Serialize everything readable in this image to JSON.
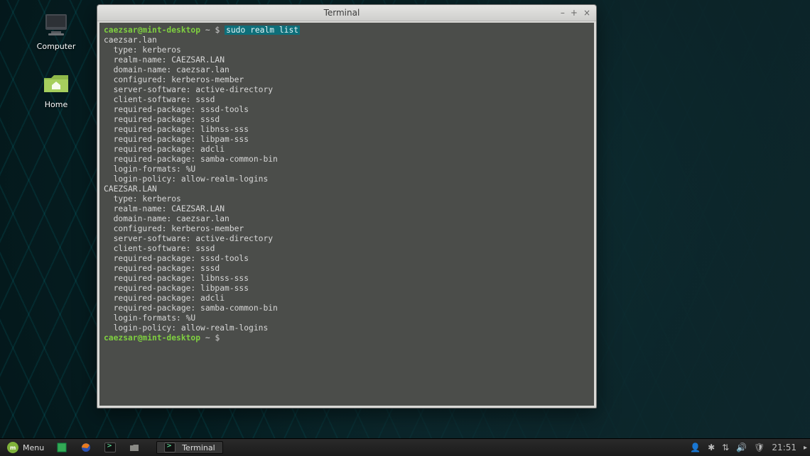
{
  "desktop": {
    "icons": [
      {
        "name": "computer",
        "label": "Computer"
      },
      {
        "name": "home",
        "label": "Home"
      }
    ]
  },
  "window": {
    "title": "Terminal",
    "controls": {
      "minimize": "–",
      "maximize": "+",
      "close": "×"
    }
  },
  "terminal": {
    "user": "caezsar",
    "host": "mint-desktop",
    "cwd": "~",
    "command": "sudo realm list",
    "output_lines": [
      "caezsar.lan",
      "  type: kerberos",
      "  realm-name: CAEZSAR.LAN",
      "  domain-name: caezsar.lan",
      "  configured: kerberos-member",
      "  server-software: active-directory",
      "  client-software: sssd",
      "  required-package: sssd-tools",
      "  required-package: sssd",
      "  required-package: libnss-sss",
      "  required-package: libpam-sss",
      "  required-package: adcli",
      "  required-package: samba-common-bin",
      "  login-formats: %U",
      "  login-policy: allow-realm-logins",
      "CAEZSAR.LAN",
      "  type: kerberos",
      "  realm-name: CAEZSAR.LAN",
      "  domain-name: caezsar.lan",
      "  configured: kerberos-member",
      "  server-software: active-directory",
      "  client-software: sssd",
      "  required-package: sssd-tools",
      "  required-package: sssd",
      "  required-package: libnss-sss",
      "  required-package: libpam-sss",
      "  required-package: adcli",
      "  required-package: samba-common-bin",
      "  login-formats: %U",
      "  login-policy: allow-realm-logins"
    ]
  },
  "panel": {
    "menu_label": "Menu",
    "launchers": [
      "show-desktop",
      "firefox",
      "terminal",
      "files"
    ],
    "active_task": "Terminal",
    "tray": {
      "user_icon": "👤",
      "bluetooth_icon": "✱",
      "network_icon": "⇅",
      "volume_icon": "🔊",
      "shield_icon": "🛡",
      "clock": "21:51"
    }
  }
}
